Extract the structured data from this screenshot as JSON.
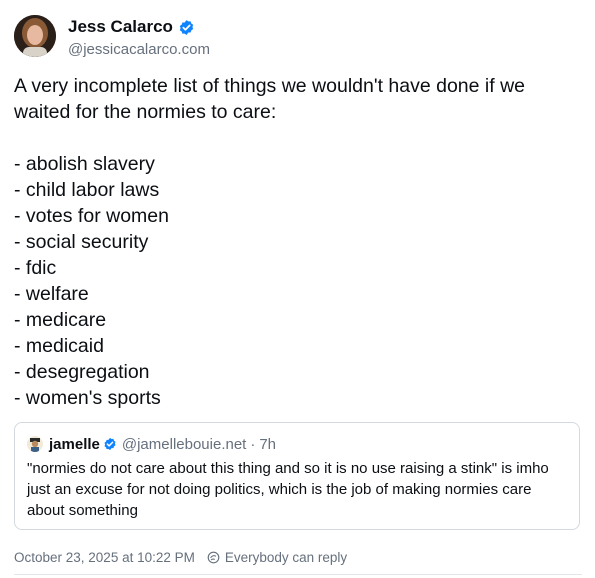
{
  "author": {
    "name": "Jess Calarco",
    "handle": "@jessicacalarco.com",
    "verified_icon": "verified-badge-icon"
  },
  "post": {
    "intro": "A very incomplete list of things we wouldn't have done if we waited for the normies to care:",
    "items": [
      "- abolish slavery",
      "- child labor laws",
      "- votes for women",
      "- social security",
      "- fdic",
      "- welfare",
      "- medicare",
      "- medicaid",
      "- desegregation",
      "- women's sports"
    ]
  },
  "quote": {
    "name": "jamelle",
    "handle": "@jamellebouie.net",
    "separator": "·",
    "time": "7h",
    "text": "\"normies do not care about this thing and so it is no use raising a stink\" is imho just an excuse for not doing politics, which is the job of making normies care about something"
  },
  "meta": {
    "date": "October 23, 2025 at 10:22 PM",
    "separator": "",
    "reply_setting": "Everybody can reply"
  },
  "colors": {
    "accent": "#1083fe",
    "muted": "#66707d",
    "border": "#d4d9df"
  }
}
